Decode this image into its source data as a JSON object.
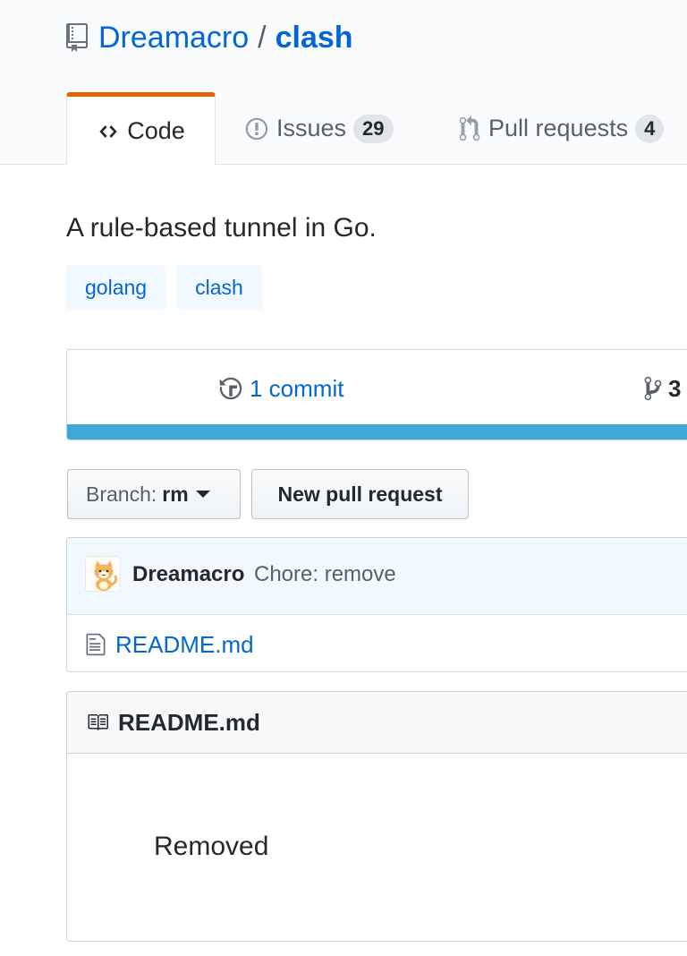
{
  "repo": {
    "owner": "Dreamacro",
    "separator": "/",
    "name": "clash"
  },
  "tabs": [
    {
      "label": "Code",
      "icon": "code-icon",
      "selected": true
    },
    {
      "label": "Issues",
      "icon": "issue-opened-icon",
      "count": "29"
    },
    {
      "label": "Pull requests",
      "icon": "git-pull-request-icon",
      "count": "4"
    }
  ],
  "description": "A rule-based tunnel in Go.",
  "topics": [
    "golang",
    "clash"
  ],
  "summary": {
    "commits": "1 commit",
    "branches_count": "3",
    "language_bar_color": "#3fa9d6"
  },
  "buttons": {
    "branch_prefix": "Branch:",
    "branch_name": "rm",
    "new_pull_request": "New pull request"
  },
  "latest_commit": {
    "author": "Dreamacro",
    "message": "Chore: remove",
    "avatar_icon": "cat-avatar"
  },
  "files": [
    {
      "name": "README.md",
      "icon": "file-text-icon"
    }
  ],
  "readme": {
    "title": "README.md",
    "icon": "book-icon",
    "body": "Removed"
  },
  "colors": {
    "link": "#0366d6",
    "tab_accent": "#e36209",
    "topic_bg": "#f1f8ff"
  }
}
